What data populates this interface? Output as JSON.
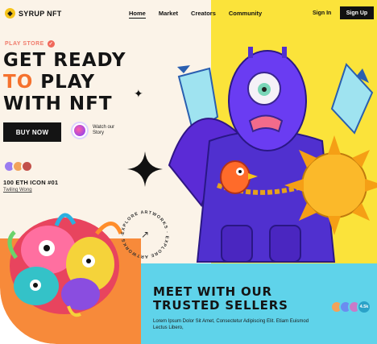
{
  "brand": {
    "name": "SYRUP NFT",
    "logo_icon": "syrup-drop-icon"
  },
  "nav": {
    "items": [
      "Home",
      "Market",
      "Creators",
      "Community"
    ],
    "active": "Home"
  },
  "auth": {
    "signin_label": "Sign In",
    "signup_label": "Sign Up"
  },
  "hero": {
    "tag": "PLAY STORE",
    "headline_line1": "GET READY",
    "headline_line2_accent": "TO",
    "headline_line2_rest": " PLAY",
    "headline_line3": "WITH NFT",
    "cta_label": "BUY NOW",
    "watch_label": "Watch our Story"
  },
  "featured": {
    "title": "100 ETH ICON #01",
    "creator": "Twiling Wong"
  },
  "explore": {
    "badge_text": "EXPLORE ARTWORKS · EXPLORE ARTWORKS ·"
  },
  "sellers": {
    "title_line1": "MEET WITH OUR",
    "title_line2": "TRUSTED SELLERS",
    "subtitle": "Lorem Ipsum Dolor Sit Amet, Consectetur Adipiscing Elit. Etiam Euismod Lectus Libero,",
    "count": "4.5k"
  },
  "colors": {
    "accent_orange": "#f5722e",
    "yellow_panel": "#fbe33a",
    "cyan_panel": "#5fd3ea",
    "dark": "#141414"
  }
}
